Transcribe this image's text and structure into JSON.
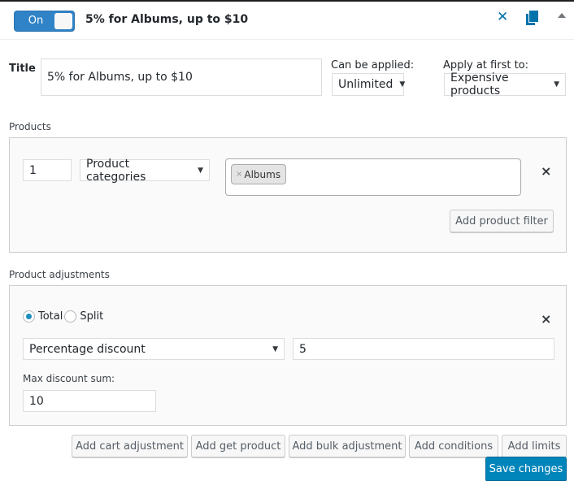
{
  "header": {
    "toggle_label": "On",
    "toggle_state": "on",
    "rule_title": "5% for Albums, up to $10",
    "icons": [
      "close-icon",
      "copy-icon",
      "collapse-icon"
    ]
  },
  "title_row": {
    "title_label": "Title",
    "title_value": "5% for Albums, up to $10",
    "can_be_applied_label": "Can be applied:",
    "can_be_applied_value": "Unlimited",
    "apply_first_label": "Apply at first to:",
    "apply_first_value": "Expensive products"
  },
  "products": {
    "section_label": "Products",
    "quantity_value": "1",
    "filter_type": "Product categories",
    "tags": [
      {
        "label": "Albums",
        "remove": "×"
      }
    ],
    "remove_icon": "×",
    "add_filter_button": "Add product filter"
  },
  "adjustments": {
    "section_label": "Product adjustments",
    "radio_options": [
      {
        "label": "Total",
        "checked": true
      },
      {
        "label": "Split",
        "checked": false
      }
    ],
    "remove_icon": "×",
    "discount_type": "Percentage discount",
    "discount_value": "5",
    "max_sum_label": "Max discount sum:",
    "max_sum_value": "10"
  },
  "actions": {
    "buttons": [
      "Add cart adjustment",
      "Add get product",
      "Add bulk adjustment",
      "Add conditions",
      "Add limits"
    ],
    "save_button": "Save changes"
  },
  "colors": {
    "accent": "#0073aa",
    "toggle": "#2f83c6",
    "primary_button": "#0085ba"
  }
}
